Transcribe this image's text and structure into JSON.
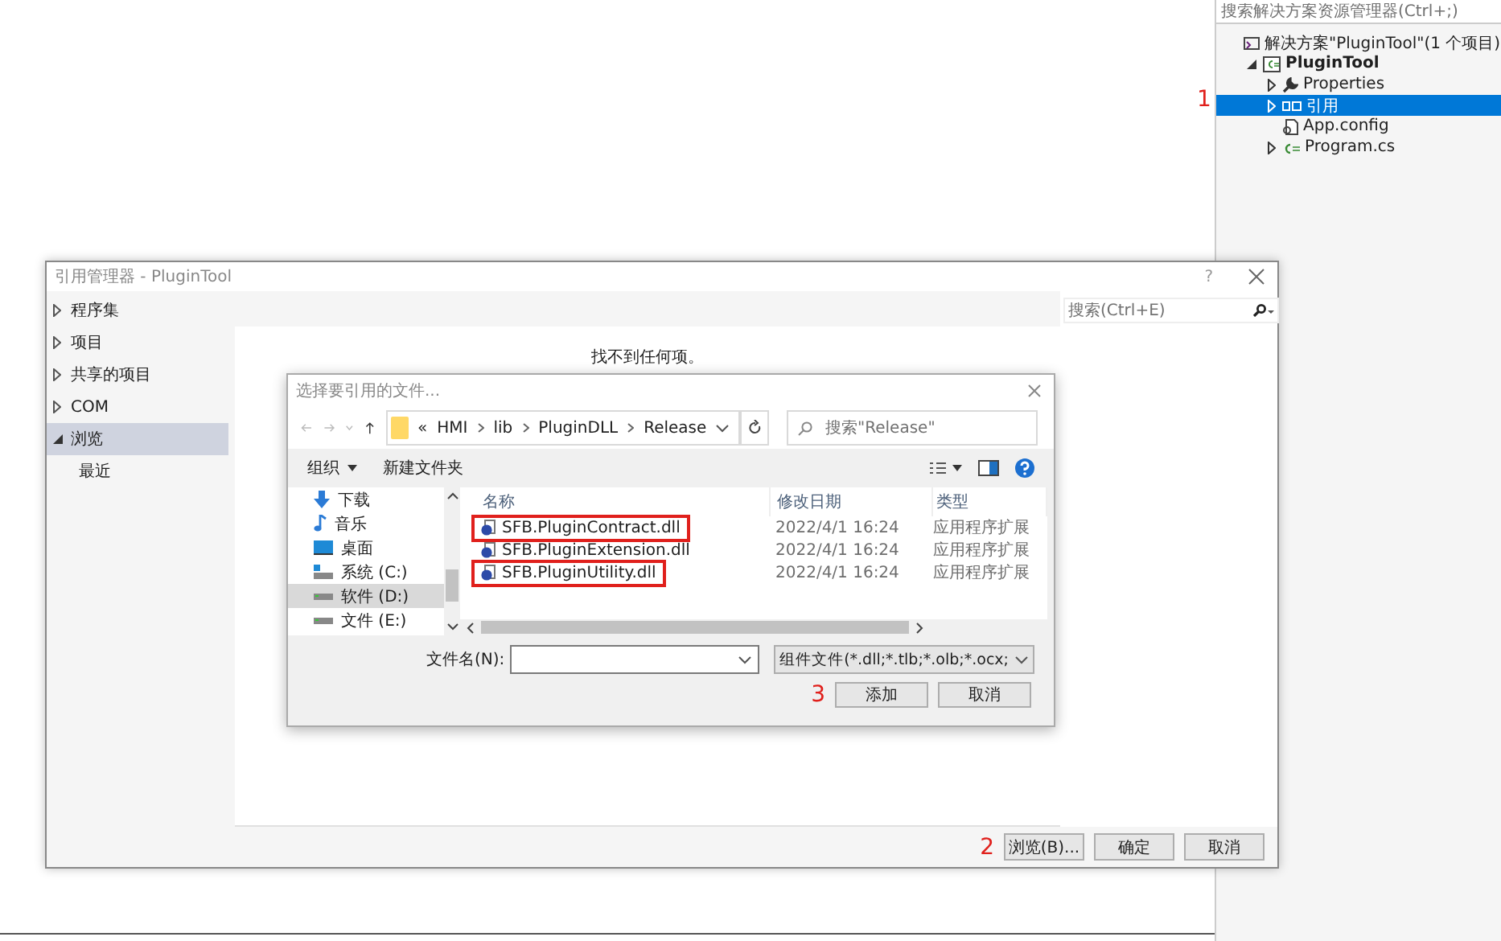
{
  "solution_explorer": {
    "search": {
      "placeholder": "搜索解决方案资源管理器(Ctrl+;)"
    },
    "step_marker": "1",
    "tree": [
      {
        "label": "解决方案\"PluginTool\"(1 个项目)",
        "kind": "solution",
        "selected": false,
        "children": [
          {
            "label": "PluginTool",
            "kind": "project",
            "expanded": true,
            "selected": false,
            "children": [
              {
                "label": "Properties",
                "kind": "properties",
                "expanded": false,
                "selected": false
              },
              {
                "label": "引用",
                "kind": "references",
                "expanded": false,
                "selected": true
              },
              {
                "label": "App.config",
                "kind": "config",
                "selected": false
              },
              {
                "label": "Program.cs",
                "kind": "csharp",
                "expanded": false,
                "selected": false
              }
            ]
          }
        ]
      }
    ]
  },
  "reference_manager": {
    "title": "引用管理器 - PluginTool",
    "help": "?",
    "categories": [
      {
        "label": "程序集",
        "expanded": false,
        "selected": false
      },
      {
        "label": "项目",
        "expanded": false,
        "selected": false
      },
      {
        "label": "共享的项目",
        "expanded": false,
        "selected": false
      },
      {
        "label": "COM",
        "expanded": false,
        "selected": false
      },
      {
        "label": "浏览",
        "expanded": true,
        "selected": true,
        "children": [
          {
            "label": "最近",
            "selected": false
          }
        ]
      }
    ],
    "search": {
      "placeholder": "搜索(Ctrl+E)"
    },
    "empty_message": "找不到任何项。",
    "step_marker": "2",
    "buttons": [
      "浏览(B)...",
      "确定",
      "取消"
    ]
  },
  "file_dialog": {
    "title": "选择要引用的文件...",
    "path_overflow": "«",
    "path": [
      "HMI",
      "lib",
      "PluginDLL",
      "Release"
    ],
    "search": {
      "placeholder": "搜索\"Release\""
    },
    "organize": "组织",
    "new_folder": "新建文件夹",
    "nav_items": [
      {
        "label": "下载",
        "kind": "downloads",
        "selected": false
      },
      {
        "label": "音乐",
        "kind": "music",
        "selected": false
      },
      {
        "label": "桌面",
        "kind": "desktop",
        "selected": false
      },
      {
        "label": "系统 (C:)",
        "kind": "system-drive",
        "selected": false
      },
      {
        "label": "软件 (D:)",
        "kind": "drive",
        "selected": true
      },
      {
        "label": "文件 (E:)",
        "kind": "drive",
        "selected": false
      }
    ],
    "columns": [
      "名称",
      "修改日期",
      "类型"
    ],
    "files": [
      {
        "name": "SFB.PluginContract.dll",
        "modified": "2022/4/1 16:24",
        "type": "应用程序扩展",
        "highlighted": true
      },
      {
        "name": "SFB.PluginExtension.dll",
        "modified": "2022/4/1 16:24",
        "type": "应用程序扩展",
        "highlighted": false
      },
      {
        "name": "SFB.PluginUtility.dll",
        "modified": "2022/4/1 16:24",
        "type": "应用程序扩展",
        "highlighted": true
      }
    ],
    "filename_label": "文件名(N):",
    "filter": "组件文件(*.dll;*.tlb;*.olb;*.ocx;",
    "step_marker": "3",
    "buttons": [
      "添加",
      "取消"
    ]
  }
}
